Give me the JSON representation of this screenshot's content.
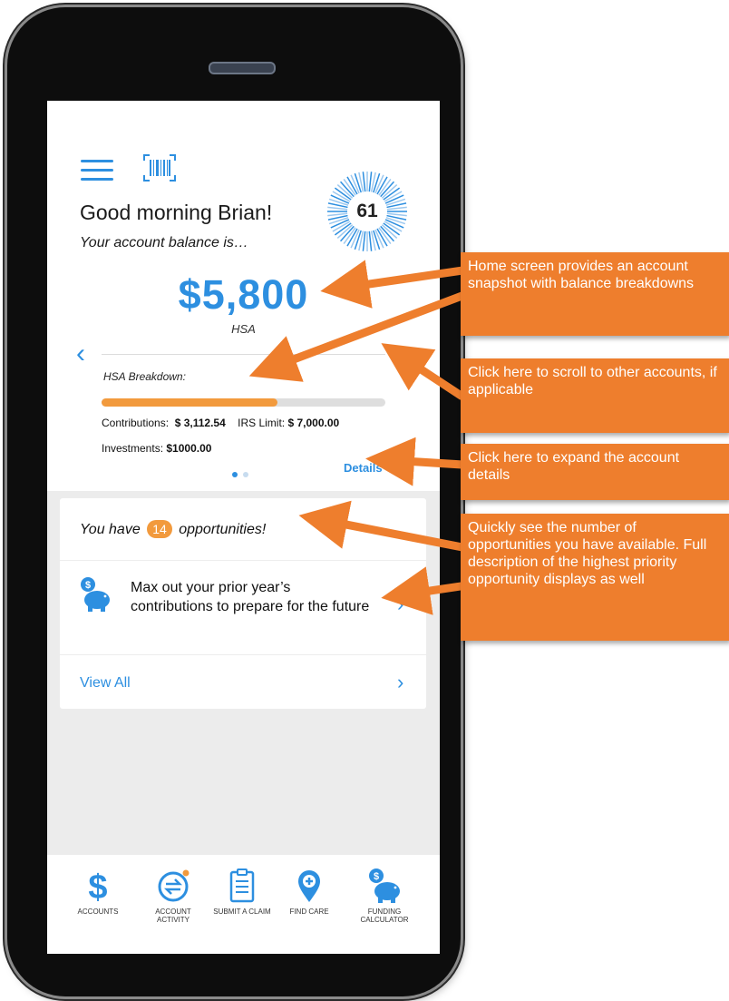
{
  "header": {
    "greeting": "Good morning Brian!",
    "balance_intro": "Your account balance is…",
    "score": "61",
    "menu_icon": "hamburger-menu-icon",
    "barcode_icon": "barcode-scan-icon"
  },
  "account": {
    "balance": "$5,800",
    "type": "HSA",
    "breakdown_title": "HSA Breakdown:",
    "contributions_label": "Contributions:",
    "contributions_value": "$ 3,112.54",
    "irs_limit_label": "IRS Limit:",
    "irs_limit_value": "$ 7,000.00",
    "investments_label": "Investments:",
    "investments_value": "$1000.00",
    "progress_fraction": 0.62,
    "details_label": "Details",
    "pager": {
      "pages": 2,
      "active": 0
    }
  },
  "opportunities": {
    "prefix": "You have",
    "count": "14",
    "suffix": "opportunities!",
    "top_item": "Max out your prior year’s contributions to prepare for the future",
    "view_all": "View All"
  },
  "bottom_nav": [
    {
      "label": "ACCOUNTS",
      "icon": "dollar-icon"
    },
    {
      "label": "ACCOUNT ACTIVITY",
      "icon": "activity-exchange-icon"
    },
    {
      "label": "SUBMIT A CLAIM",
      "icon": "clipboard-icon"
    },
    {
      "label": "FIND CARE",
      "icon": "map-pin-plus-icon"
    },
    {
      "label": "FUNDING CALCULATOR",
      "icon": "piggy-bank-icon"
    }
  ],
  "callouts": [
    "Home screen provides an account snapshot with balance breakdowns",
    "Click here to scroll to other accounts, if applicable",
    "Click here to expand the account details",
    "Quickly see the number of opportunities you have available. Full description of the highest priority opportunity displays as well"
  ],
  "colors": {
    "accent_blue": "#2d8fe0",
    "accent_orange": "#f29a3d",
    "callout_orange": "#ee7e2d",
    "grey_bg": "#ececec"
  }
}
